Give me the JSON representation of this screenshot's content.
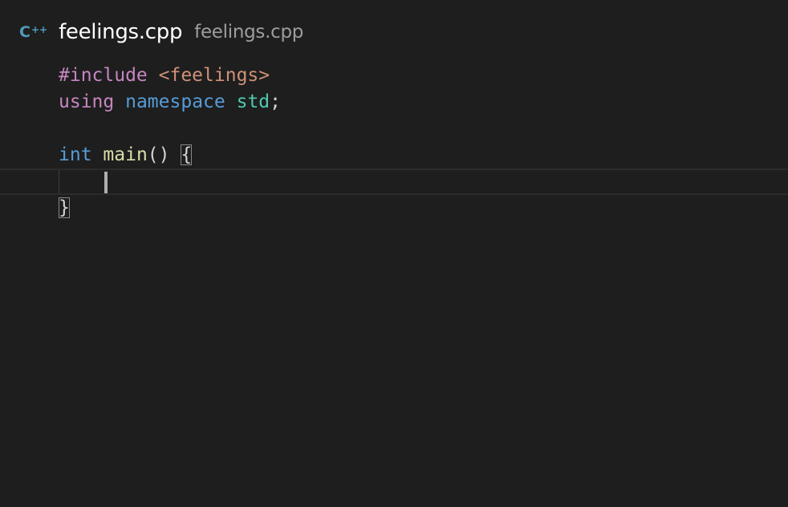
{
  "header": {
    "language_icon": "C",
    "language_icon_suffix": "++",
    "file_name": "feelings.cpp",
    "file_description": "feelings.cpp"
  },
  "code": {
    "line1": {
      "directive": "#include",
      "header": "<feelings>"
    },
    "line2": {
      "kw": "using",
      "ns_kw": "namespace",
      "ns": "std",
      "semi": ";"
    },
    "line4": {
      "type": "int",
      "func": "main",
      "parens": "()",
      "open_brace": "{"
    },
    "line6": {
      "close_brace": "}"
    }
  },
  "colors": {
    "background": "#1e1e1e",
    "icon_cpp": "#519aba",
    "preprocessor": "#c586c0",
    "string": "#ce9178",
    "storage_type": "#569cd6",
    "namespace": "#4ec9b0",
    "function": "#dcdcaa"
  }
}
